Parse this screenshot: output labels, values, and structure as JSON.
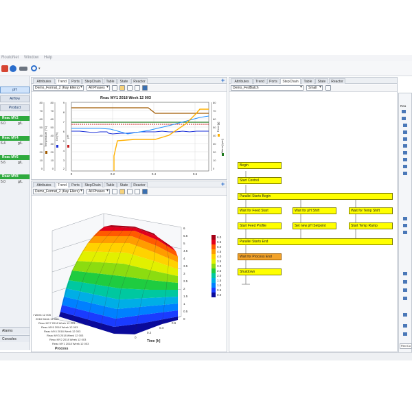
{
  "menu": [
    "RoutoNet",
    "Window",
    "Help"
  ],
  "nav": {
    "items": [
      {
        "label": "pH",
        "active": true
      },
      {
        "label": "Airflow",
        "active": false
      },
      {
        "label": "Product",
        "active": false
      }
    ],
    "sensors": [
      {
        "name": "Reac MY2",
        "value": "6.0",
        "unit": "g/L"
      },
      {
        "name": "Reac MY4",
        "value": "6.4",
        "unit": "g/L"
      },
      {
        "name": "Reac MY6",
        "value": "5.6",
        "unit": "g/L"
      },
      {
        "name": "Reac MY8",
        "value": "5.0",
        "unit": "g/L"
      }
    ],
    "bottom": [
      "Alarms",
      "Consoles"
    ]
  },
  "tabs_main": [
    "Attributes",
    "Trend",
    "Ports",
    "StepChain",
    "Table",
    "State",
    "Reactor"
  ],
  "tabs_bottom": [
    "Attributes",
    "Trend",
    "Ports",
    "StepChain",
    "Table",
    "State",
    "Reactor"
  ],
  "tabs_right": [
    "Attributes",
    "Trend",
    "Ports",
    "StepChain",
    "Table",
    "State",
    "Reactor"
  ],
  "trend": {
    "format_combo": "Demo_Format_2 (Kay Ellers)",
    "phases_combo": "All Phases",
    "title": "Reac MY1 2018 Week 12 003",
    "x_ticks": [
      "0",
      "0.2",
      "0.4",
      "0.6"
    ],
    "left_axes": [
      {
        "label": "Temperature [°C]",
        "ticks": [
          "80",
          "70",
          "60",
          "50",
          "40",
          "30",
          "20",
          "10",
          "0"
        ]
      },
      {
        "label": "Do [%]",
        "ticks": [
          "80",
          "70",
          "60",
          "50",
          "40",
          "30",
          "20",
          "10",
          "0"
        ]
      },
      {
        "label": "pH",
        "ticks": [
          "9",
          "8",
          "7",
          "6",
          "5",
          "4",
          "3",
          "2"
        ]
      }
    ],
    "right_axes": [
      {
        "label": "Feed [g]",
        "ticks": [
          "80",
          "70",
          "60",
          "50",
          "40",
          "30",
          "20",
          "10",
          "0"
        ]
      },
      {
        "label": "Stirrer [rpm]",
        "ticks": [
          "600",
          "500",
          "400",
          "300",
          "200",
          "100",
          "0"
        ]
      }
    ]
  },
  "process3d": {
    "format_combo": "Demo_Format_2 (Kay Ellers)",
    "phases_combo": "All Phases",
    "z_ticks": [
      "6",
      "5.5",
      "5",
      "4.5",
      "4",
      "3.5",
      "3",
      "2.5",
      "2",
      "1.5",
      "1",
      "0.5",
      "0"
    ],
    "time_ticks": [
      "0",
      "0.2",
      "0.4",
      "0.6"
    ],
    "time_label": "Time [h]",
    "process_label": "Process",
    "runs": [
      "r Week 12 005",
      "2018 Week 12 005",
      "Reac MY7 2018 Week 12 003",
      "Reac MY6 2018 Week 12 003",
      "Reac MY4 2018 Week 12 003",
      "Reac MY3 2018 Week 12 003",
      "Reac MY2 2018 Week 12 003",
      "Reac MY1 2018 Week 12 003"
    ],
    "legend": [
      {
        "value": "6.0",
        "color": "#a50016"
      },
      {
        "value": "5.5",
        "color": "#e3001b"
      },
      {
        "value": "5.0",
        "color": "#ff5a00"
      },
      {
        "value": "4.5",
        "color": "#ff9c00"
      },
      {
        "value": "4.0",
        "color": "#ffd200"
      },
      {
        "value": "3.5",
        "color": "#e1f000"
      },
      {
        "value": "3.0",
        "color": "#8cdc10"
      },
      {
        "value": "2.5",
        "color": "#1fcc40"
      },
      {
        "value": "2.0",
        "color": "#00c8a0"
      },
      {
        "value": "1.5",
        "color": "#00aee6"
      },
      {
        "value": "1.0",
        "color": "#0080ff"
      },
      {
        "value": "0.5",
        "color": "#1a3cff"
      },
      {
        "value": "0.0",
        "color": "#0a0a9a"
      }
    ]
  },
  "stepchain": {
    "combo": "Demo_FedBatch",
    "size_combo": "Small",
    "steps": {
      "begin": "Begin",
      "start_control": "Start Control",
      "par_begin": "Parallel Starts Begin",
      "wait_feed": "Wait for Feed Start",
      "wait_ph": "Wait for pH Shift",
      "wait_temp": "Wait for Temp Shift",
      "start_feed": "Start Feed Profile",
      "set_ph": "Set new pH Setpoint",
      "start_temp": "Start Temp Ramp",
      "par_end": "Parallel Starts End",
      "wait_end": "Wait for Process End",
      "shutdown": "Shutdown"
    }
  },
  "tree_header": "Rea",
  "find_label": "Find Cu",
  "colors": {
    "step_fill": "#ffff00",
    "step_active": "#f2a22a",
    "accent": "#2a6dcc"
  }
}
